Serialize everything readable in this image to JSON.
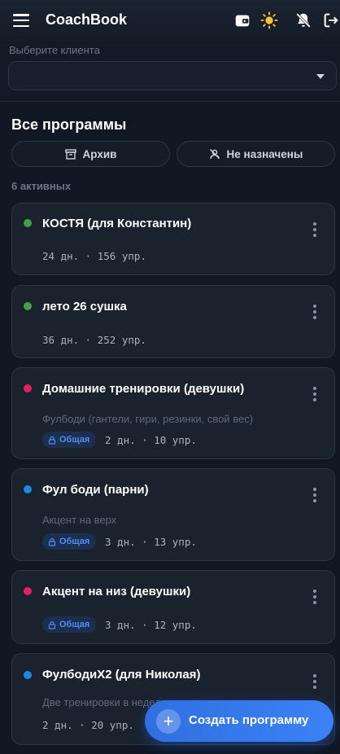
{
  "app": {
    "title": "CoachBook"
  },
  "header_icons": [
    "wallet-icon",
    "sun-icon",
    "bell-off-icon",
    "logout-icon"
  ],
  "client": {
    "label": "Выберите клиента",
    "value": ""
  },
  "section": {
    "title": "Все программы",
    "archive_label": "Архив",
    "unassigned_label": "Не назначены",
    "count_label": "6 активных"
  },
  "colors": {
    "green": "#43a047",
    "pink": "#e91e63",
    "blue": "#1e88e5",
    "accent": "#3b82f6"
  },
  "programs": [
    {
      "title": "КОСТЯ (для Константин)",
      "status_color": "#43a047",
      "description": "",
      "badge": "",
      "meta": "24 дн. · 156 упр."
    },
    {
      "title": "лето 26 сушка",
      "status_color": "#43a047",
      "description": "",
      "badge": "",
      "meta": "36 дн. · 252 упр."
    },
    {
      "title": "Домашние тренировки (девушки)",
      "status_color": "#e91e63",
      "description": "Фулбоди (гантели, гири, резинки, свой вес)",
      "badge": "Общая",
      "meta": "2 дн. · 10 упр."
    },
    {
      "title": "Фул боди (парни)",
      "status_color": "#1e88e5",
      "description": "Акцент на верх",
      "badge": "Общая",
      "meta": "3 дн. · 13 упр."
    },
    {
      "title": "Акцент на низ (девушки)",
      "status_color": "#e91e63",
      "description": "",
      "badge": "Общая",
      "meta": "3 дн. · 12 упр."
    },
    {
      "title": "ФулбодиХ2 (для Николая)",
      "status_color": "#1e88e5",
      "description": "Две тренировки в неделю",
      "badge": "",
      "meta": "2 дн. · 20 упр."
    }
  ],
  "fab": {
    "label": "Создать программу",
    "icon": "plus-icon"
  }
}
